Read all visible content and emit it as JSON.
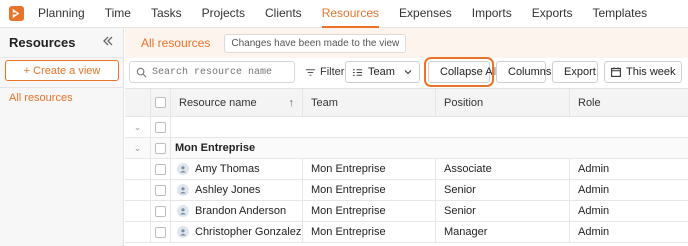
{
  "nav": {
    "items": [
      "Planning",
      "Time",
      "Tasks",
      "Projects",
      "Clients",
      "Resources",
      "Expenses",
      "Imports",
      "Exports",
      "Templates"
    ],
    "active": "Resources",
    "accent": "#e8742a"
  },
  "sidebar": {
    "title": "Resources",
    "create_label": "+ Create a view",
    "items": [
      {
        "label": "All resources"
      }
    ]
  },
  "header": {
    "view_title": "All resources",
    "changes_notice": "Changes have been made to the view"
  },
  "toolbar": {
    "search_placeholder": "Search resource name",
    "filter_label": "Filter",
    "group_value": "Team",
    "collapse_label": "Collapse All",
    "columns_label": "Columns",
    "export_label": "Export",
    "period_value": "This week"
  },
  "table": {
    "columns": [
      "Resource name",
      "Team",
      "Position",
      "Role"
    ],
    "group_name": "Mon Entreprise",
    "rows": [
      {
        "name": "Amy Thomas",
        "team": "Mon Entreprise",
        "position": "Associate",
        "role": "Admin"
      },
      {
        "name": "Ashley Jones",
        "team": "Mon Entreprise",
        "position": "Senior",
        "role": "Admin"
      },
      {
        "name": "Brandon Anderson",
        "team": "Mon Entreprise",
        "position": "Senior",
        "role": "Admin"
      },
      {
        "name": "Christopher Gonzalez",
        "team": "Mon Entreprise",
        "position": "Manager",
        "role": "Admin"
      }
    ]
  },
  "icons": {
    "logo": "app-logo-icon",
    "collapse_sidebar": "double-chevron-left-icon",
    "search": "search-icon",
    "filter": "filter-icon",
    "collapse_all": "double-chevron-right-icon",
    "columns": "columns-icon",
    "export": "export-file-icon",
    "calendar": "calendar-icon",
    "avatar": "user-icon"
  }
}
